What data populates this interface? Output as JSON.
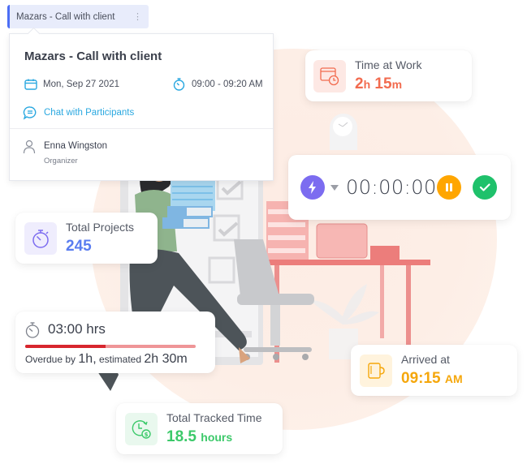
{
  "event": {
    "chip_title": "Mazars - Call with client",
    "popover_title": "Mazars - Call with client",
    "date": "Mon, Sep 27 2021",
    "time_range": "09:00 - 09:20 AM",
    "chat_link": "Chat with Participants",
    "organizer_name": "Enna Wingston",
    "organizer_role": "Organizer"
  },
  "time_at_work": {
    "label": "Time at Work",
    "hours": "2",
    "hours_unit": "h",
    "minutes": "15",
    "minutes_unit": "m",
    "color": "#f26b4f"
  },
  "timer": {
    "display": "00:00:00",
    "pause_color": "#ffa600",
    "complete_color": "#1fc16b",
    "project_color": "#7c6cf0"
  },
  "total_projects": {
    "label": "Total Projects",
    "value": "245",
    "color": "#5a7df0"
  },
  "estimate": {
    "logged": "03:00 hrs",
    "overdue_prefix": "Overdue by",
    "overdue_value": "1h,",
    "estimated_label": "estimated",
    "estimated_value": "2h 30m",
    "progress_fraction": 0.47,
    "bar_color": "#d7262e",
    "track_color": "#ef9597"
  },
  "arrived": {
    "label": "Arrived at",
    "time": "09:15",
    "period": "AM",
    "color": "#f5a70c"
  },
  "tracked": {
    "label": "Total Tracked Time",
    "value": "18.5",
    "unit": "hours",
    "color": "#3cc96a"
  }
}
